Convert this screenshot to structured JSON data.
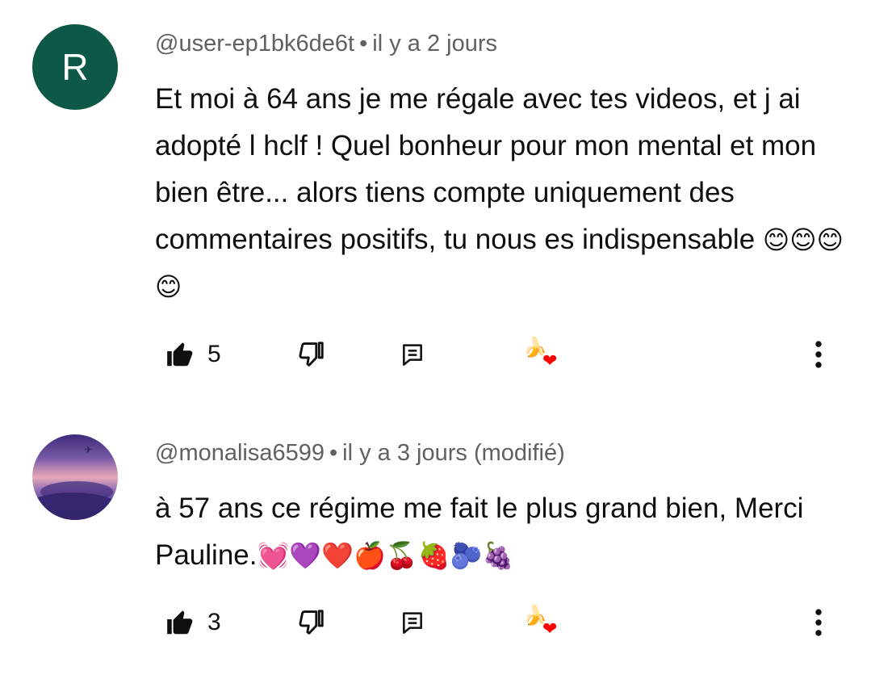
{
  "comments": [
    {
      "avatar_letter": "R",
      "avatar_color": "#0e5848",
      "handle": "@user-ep1bk6de6t",
      "separator": "•",
      "time": "il y a 2 jours",
      "text": "Et moi à 64 ans je me régale avec tes videos, et j ai adopté l hclf ! Quel bonheur pour mon mental et mon bien être... alors tiens compte uniquement des commentaires positifs, tu nous es indispensable",
      "emojis": "😊😊😊😊",
      "likes": "5",
      "creator_heart_icon": "creator-heart-icon"
    },
    {
      "avatar_letter": "",
      "handle": "@monalisa6599",
      "separator": "•",
      "time": "il y a 3 jours (modifié)",
      "text": "à 57 ans ce régime me fait le plus grand bien, Merci Pauline.",
      "emojis": "💓💜❤️🍎🍒🍓🫐🍇",
      "likes": "3",
      "creator_heart_icon": "creator-heart-icon"
    }
  ],
  "colors": {
    "text_primary": "#0f0f0f",
    "text_secondary": "#606060",
    "heart": "#ff0000",
    "background": "#ffffff"
  }
}
